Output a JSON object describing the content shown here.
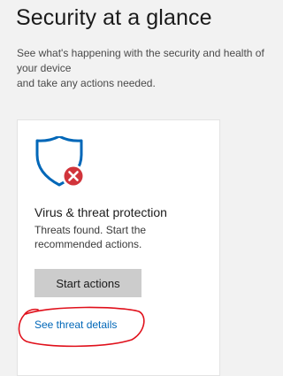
{
  "header": {
    "title": "Security at a glance",
    "description": "See what's happening with the security and health of your device\nand take any actions needed."
  },
  "virus_tile": {
    "icon": "shield-error-icon",
    "title": "Virus & threat protection",
    "description": "Threats found. Start the recommended actions.",
    "action_label": "Start actions",
    "link_label": "See threat details"
  },
  "colors": {
    "shield": "#0067b8",
    "error_badge": "#d1343b",
    "link": "#0067b8",
    "annotation": "#e0101b",
    "button": "#cccccc"
  }
}
